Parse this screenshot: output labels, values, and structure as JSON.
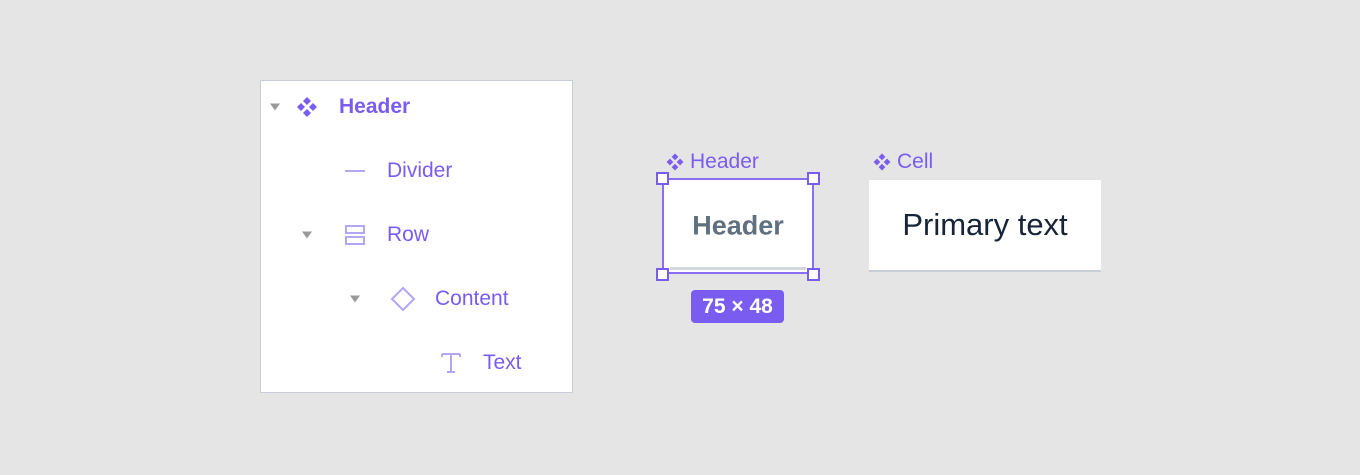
{
  "layers": {
    "items": [
      {
        "label": "Header",
        "icon": "component-icon",
        "expanded": true
      },
      {
        "label": "Divider",
        "icon": "divider-icon"
      },
      {
        "label": "Row",
        "icon": "row-icon",
        "expanded": true
      },
      {
        "label": "Content",
        "icon": "instance-icon",
        "expanded": true
      },
      {
        "label": "Text",
        "icon": "text-icon"
      }
    ]
  },
  "canvas": {
    "header_component": {
      "tag_label": "Header",
      "content_text": "Header",
      "size_badge": "75 × 48"
    },
    "cell_component": {
      "tag_label": "Cell",
      "content_text": "Primary text"
    }
  },
  "colors": {
    "accent": "#7a5cf0",
    "background": "#e5e5e5",
    "frame_text": "#5f7080",
    "cell_text": "#16243a"
  }
}
